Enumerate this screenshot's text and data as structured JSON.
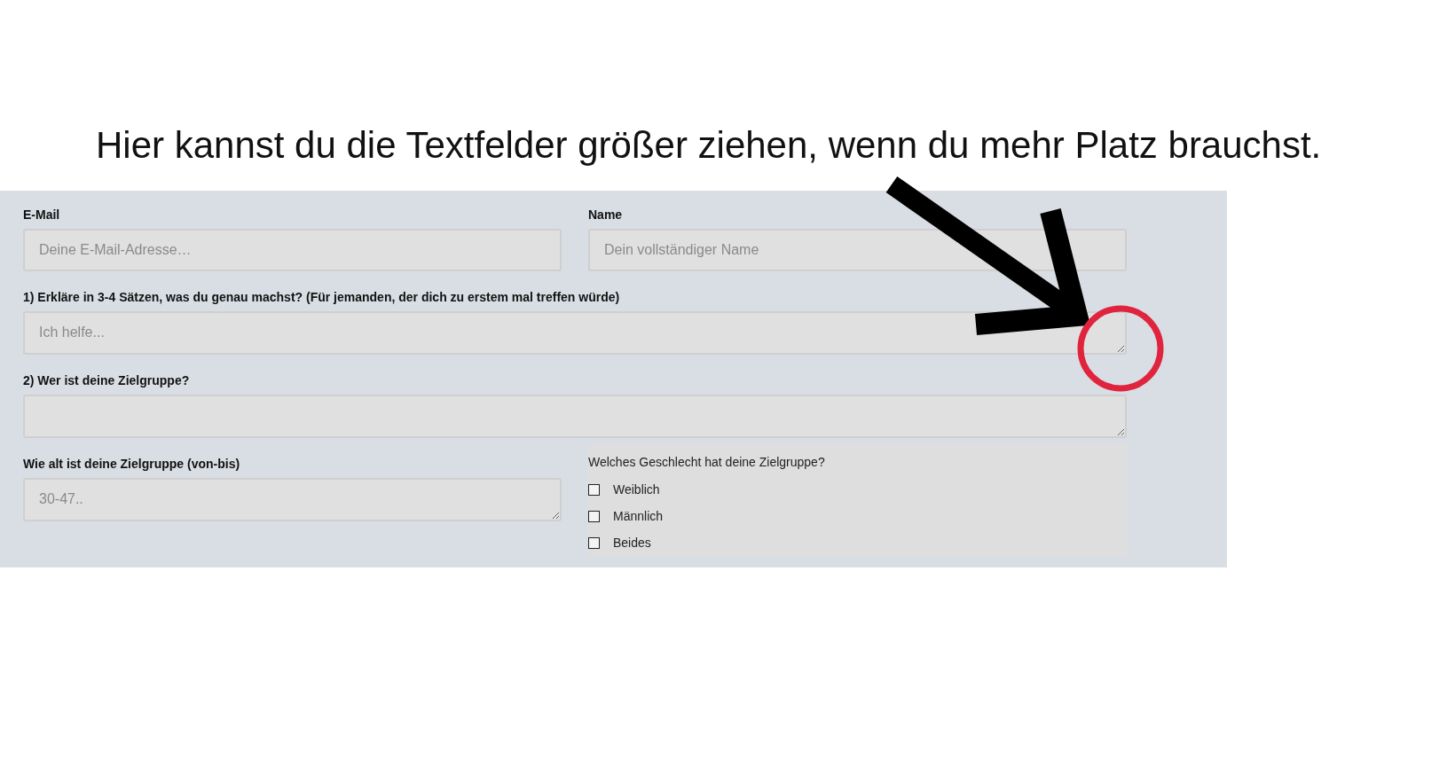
{
  "heading": "Hier kannst du die Textfelder größer ziehen, wenn du mehr Platz brauchst.",
  "rows": [
    {
      "items": [
        {
          "kind": "input",
          "label": "E-Mail",
          "placeholder": "Deine E-Mail-Adresse…"
        },
        {
          "kind": "input",
          "label": "Name",
          "placeholder": "Dein vollständiger Name"
        }
      ]
    },
    {
      "items": [
        {
          "kind": "textarea",
          "label": "1) Erkläre in 3-4 Sätzen, was du genau machst? (Für jemanden, der dich zu erstem mal treffen würde)",
          "placeholder": "Ich helfe..."
        }
      ]
    },
    {
      "items": [
        {
          "kind": "textarea",
          "label": "2) Wer ist deine Zielgruppe?"
        }
      ]
    },
    {
      "items": [
        {
          "kind": "textarea",
          "label": "Wie alt ist deine Zielgruppe (von-bis)",
          "placeholder": "30-47.."
        },
        {
          "kind": "choices",
          "label": "Welches Geschlecht hat deine Zielgruppe?",
          "options": [
            {
              "label": "Weiblich",
              "checked": false
            },
            {
              "label": "Männlich",
              "checked": false
            },
            {
              "label": "Beides",
              "checked": false
            }
          ]
        }
      ]
    }
  ]
}
